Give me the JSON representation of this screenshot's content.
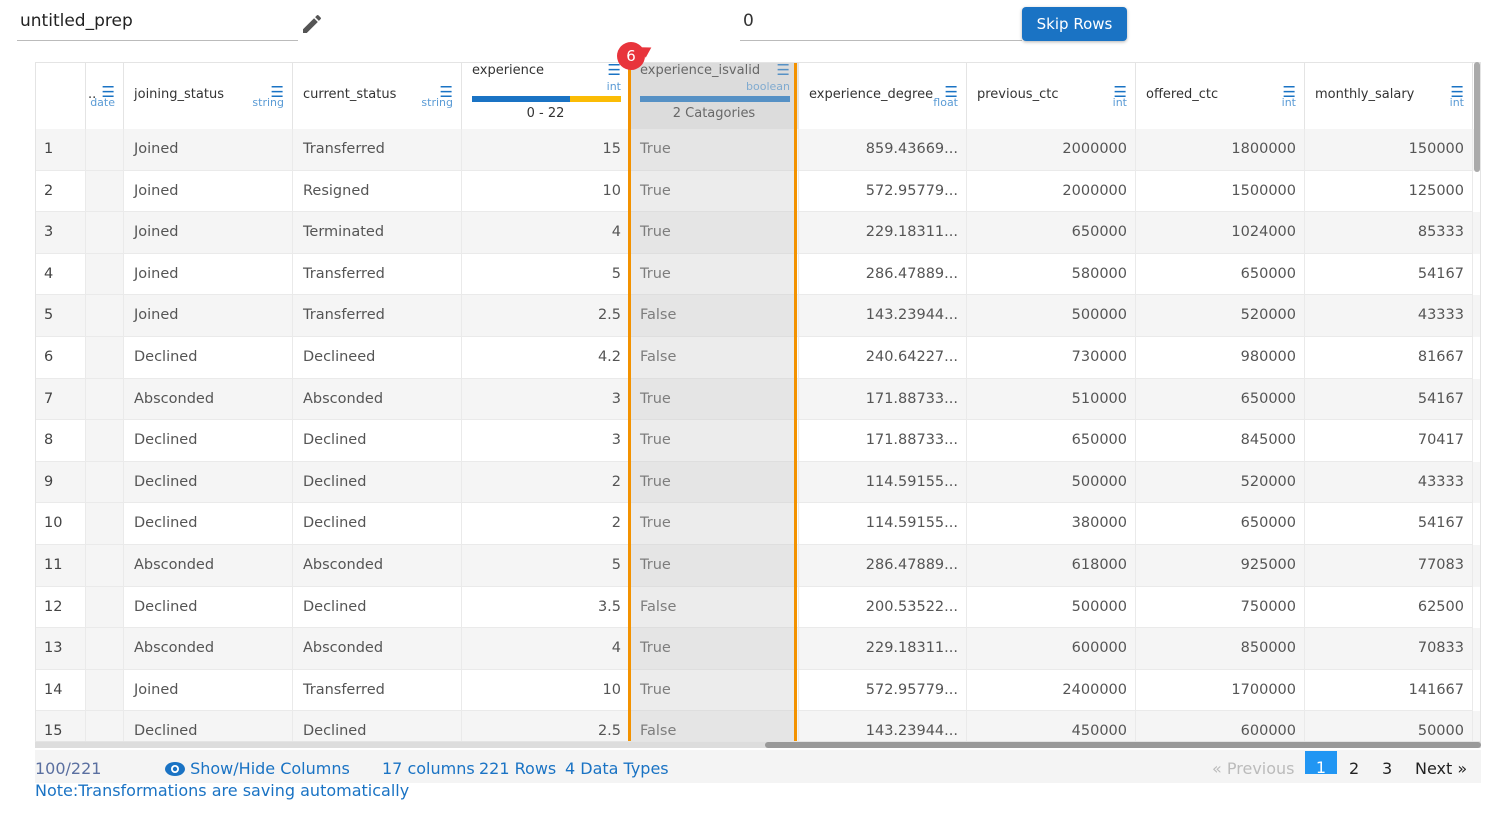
{
  "toolbar": {
    "name": "untitled_prep",
    "skip_value": "0",
    "skip_label": "Skip Rows",
    "edit_icon": "pencil-icon"
  },
  "columns": [
    {
      "name": "..",
      "type": "date"
    },
    {
      "name": "joining_status",
      "type": "string"
    },
    {
      "name": "current_status",
      "type": "string"
    },
    {
      "name": "experience",
      "type": "int",
      "range": "0 - 22"
    },
    {
      "name": "experience_isvalid",
      "type": "boolean",
      "range": "2 Catagories"
    },
    {
      "name": "experience_degree",
      "type": "float"
    },
    {
      "name": "previous_ctc",
      "type": "int"
    },
    {
      "name": "offered_ctc",
      "type": "int"
    },
    {
      "name": "monthly_salary",
      "type": "int"
    }
  ],
  "selected_badge": "6",
  "rows": [
    [
      "1",
      "",
      "Joined",
      "Transferred",
      "15",
      "True",
      "859.43669...",
      "2000000",
      "1800000",
      "150000"
    ],
    [
      "2",
      "",
      "Joined",
      "Resigned",
      "10",
      "True",
      "572.95779...",
      "2000000",
      "1500000",
      "125000"
    ],
    [
      "3",
      "",
      "Joined",
      "Terminated",
      "4",
      "True",
      "229.18311...",
      "650000",
      "1024000",
      "85333"
    ],
    [
      "4",
      "",
      "Joined",
      "Transferred",
      "5",
      "True",
      "286.47889...",
      "580000",
      "650000",
      "54167"
    ],
    [
      "5",
      "",
      "Joined",
      "Transferred",
      "2.5",
      "False",
      "143.23944...",
      "500000",
      "520000",
      "43333"
    ],
    [
      "6",
      "",
      "Declined",
      "Declineed",
      "4.2",
      "False",
      "240.64227...",
      "730000",
      "980000",
      "81667"
    ],
    [
      "7",
      "",
      "Absconded",
      "Absconded",
      "3",
      "True",
      "171.88733...",
      "510000",
      "650000",
      "54167"
    ],
    [
      "8",
      "",
      "Declined",
      "Declined",
      "3",
      "True",
      "171.88733...",
      "650000",
      "845000",
      "70417"
    ],
    [
      "9",
      "",
      "Declined",
      "Declined",
      "2",
      "True",
      "114.59155...",
      "500000",
      "520000",
      "43333"
    ],
    [
      "10",
      "",
      "Declined",
      "Declined",
      "2",
      "True",
      "114.59155...",
      "380000",
      "650000",
      "54167"
    ],
    [
      "11",
      "",
      "Absconded",
      "Absconded",
      "5",
      "True",
      "286.47889...",
      "618000",
      "925000",
      "77083"
    ],
    [
      "12",
      "",
      "Declined",
      "Declined",
      "3.5",
      "False",
      "200.53522...",
      "500000",
      "750000",
      "62500"
    ],
    [
      "13",
      "",
      "Absconded",
      "Absconded",
      "4",
      "True",
      "229.18311...",
      "600000",
      "850000",
      "70833"
    ],
    [
      "14",
      "",
      "Joined",
      "Transferred",
      "10",
      "True",
      "572.95779...",
      "2400000",
      "1700000",
      "141667"
    ],
    [
      "15",
      "",
      "Declined",
      "Declined",
      "2.5",
      "False",
      "143.23944...",
      "450000",
      "600000",
      "50000"
    ]
  ],
  "footer": {
    "count": "100/221",
    "show_hide": "Show/Hide Columns",
    "columns": "17 columns",
    "rows": "221 Rows",
    "types": "4 Data Types",
    "note": "Note:Transformations are saving automatically"
  },
  "pagination": {
    "prev": "Previous",
    "pages": [
      "1",
      "2",
      "3"
    ],
    "next": "Next",
    "current": "1"
  },
  "colors": {
    "accent": "#1a73c4",
    "selection": "#f39200",
    "badge": "#e8343c",
    "bar_secondary": "#fbbc05"
  }
}
